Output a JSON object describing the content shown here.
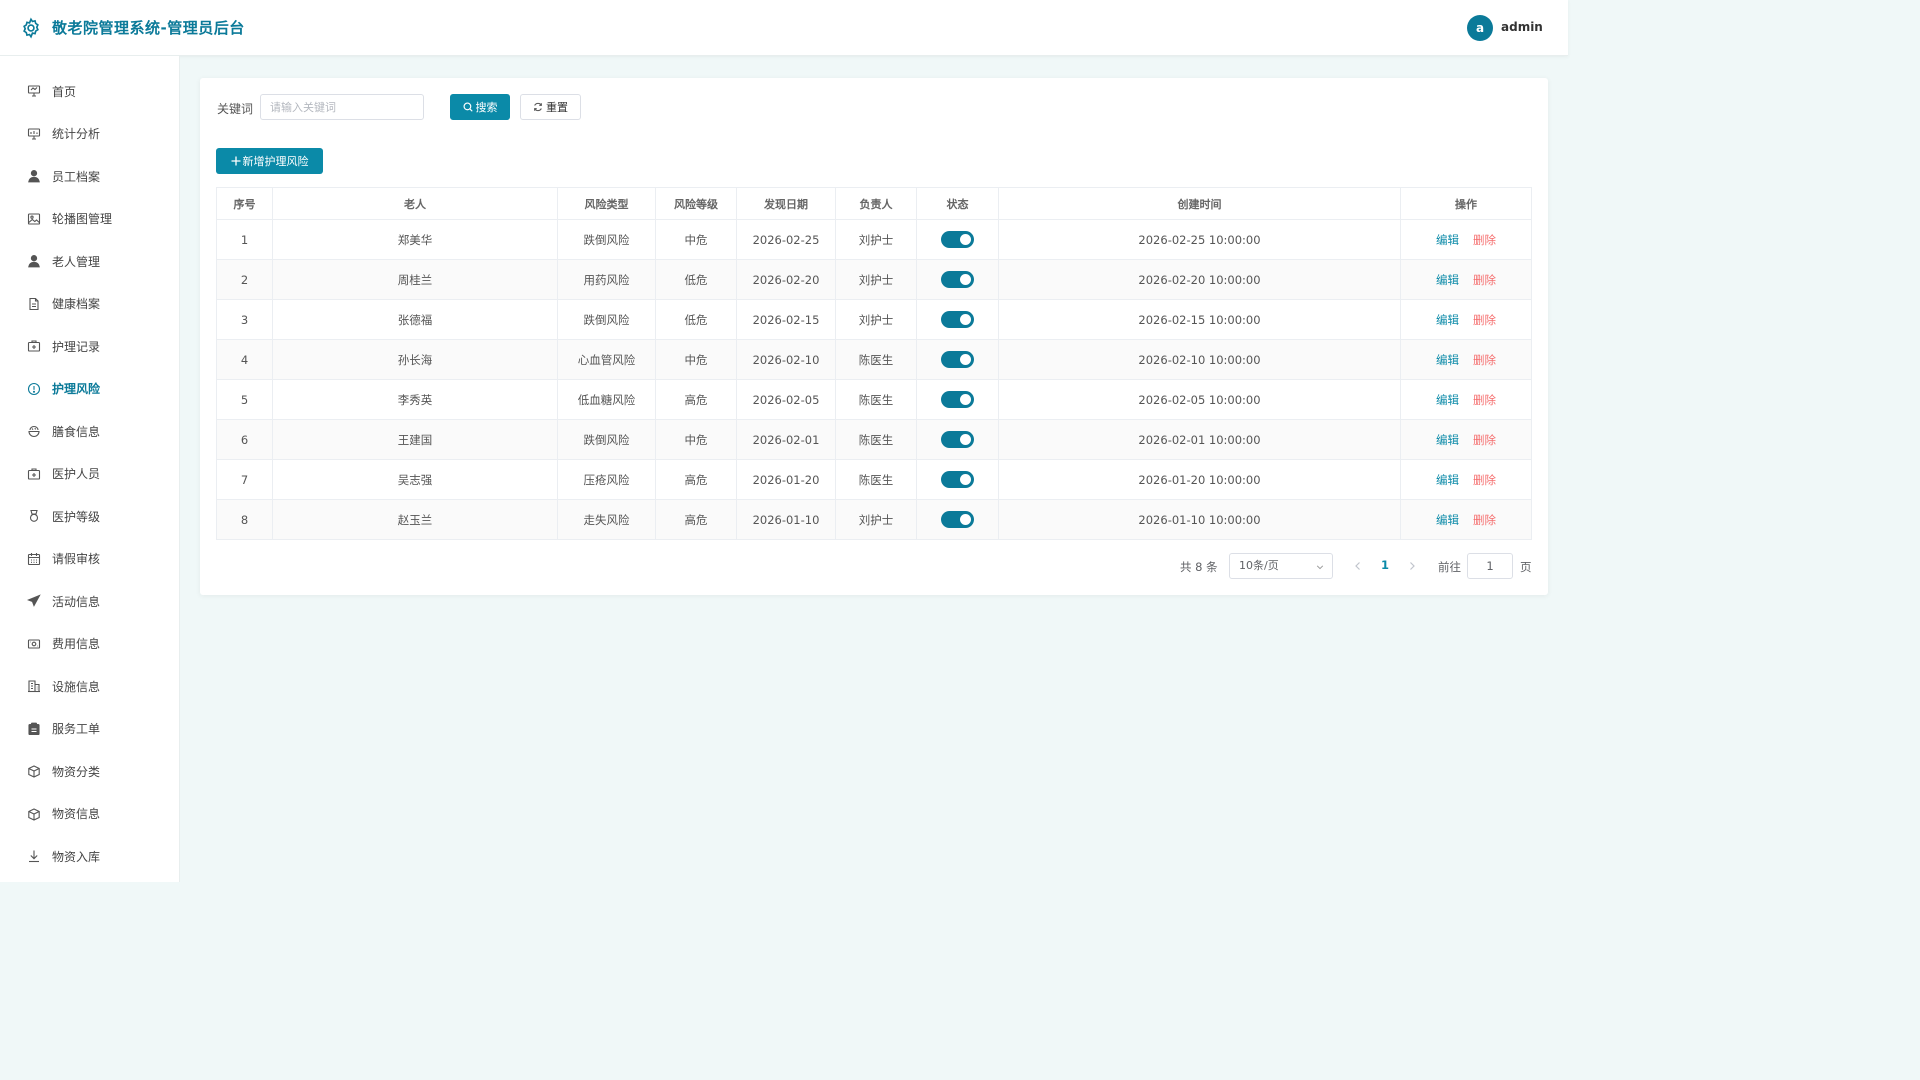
{
  "header": {
    "title": "敬老院管理系统-管理员后台",
    "avatar_letter": "a",
    "username": "admin"
  },
  "sidebar": {
    "items": [
      {
        "label": "首页",
        "icon": "presentation-icon"
      },
      {
        "label": "统计分析",
        "icon": "chart-board-icon"
      },
      {
        "label": "员工档案",
        "icon": "user-icon"
      },
      {
        "label": "轮播图管理",
        "icon": "picture-icon"
      },
      {
        "label": "老人管理",
        "icon": "user-icon"
      },
      {
        "label": "健康档案",
        "icon": "document-icon"
      },
      {
        "label": "护理记录",
        "icon": "first-aid-icon"
      },
      {
        "label": "护理风险",
        "icon": "warning-circle-icon",
        "active": true
      },
      {
        "label": "膳食信息",
        "icon": "food-icon"
      },
      {
        "label": "医护人员",
        "icon": "first-aid-icon"
      },
      {
        "label": "医护等级",
        "icon": "medal-icon"
      },
      {
        "label": "请假审核",
        "icon": "calendar-icon"
      },
      {
        "label": "活动信息",
        "icon": "paper-plane-icon"
      },
      {
        "label": "费用信息",
        "icon": "money-icon"
      },
      {
        "label": "设施信息",
        "icon": "office-building-icon"
      },
      {
        "label": "服务工单",
        "icon": "clipboard-icon"
      },
      {
        "label": "物资分类",
        "icon": "box-icon"
      },
      {
        "label": "物资信息",
        "icon": "box-icon"
      },
      {
        "label": "物资入库",
        "icon": "download-icon"
      }
    ]
  },
  "search": {
    "keyword_label": "关键词",
    "placeholder": "请输入关键词",
    "search_label": "搜索",
    "reset_label": "重置"
  },
  "toolbar": {
    "add_label": "新增护理风险"
  },
  "table": {
    "columns": [
      "序号",
      "老人",
      "风险类型",
      "风险等级",
      "发现日期",
      "负责人",
      "状态",
      "创建时间",
      "操作"
    ],
    "rows": [
      {
        "no": "1",
        "elder": "郑美华",
        "type": "跌倒风险",
        "level": "中危",
        "date": "2026-02-25",
        "owner": "刘护士",
        "status": true,
        "created": "2026-02-25 10:00:00"
      },
      {
        "no": "2",
        "elder": "周桂兰",
        "type": "用药风险",
        "level": "低危",
        "date": "2026-02-20",
        "owner": "刘护士",
        "status": true,
        "created": "2026-02-20 10:00:00"
      },
      {
        "no": "3",
        "elder": "张德福",
        "type": "跌倒风险",
        "level": "低危",
        "date": "2026-02-15",
        "owner": "刘护士",
        "status": true,
        "created": "2026-02-15 10:00:00"
      },
      {
        "no": "4",
        "elder": "孙长海",
        "type": "心血管风险",
        "level": "中危",
        "date": "2026-02-10",
        "owner": "陈医生",
        "status": true,
        "created": "2026-02-10 10:00:00"
      },
      {
        "no": "5",
        "elder": "李秀英",
        "type": "低血糖风险",
        "level": "高危",
        "date": "2026-02-05",
        "owner": "陈医生",
        "status": true,
        "created": "2026-02-05 10:00:00"
      },
      {
        "no": "6",
        "elder": "王建国",
        "type": "跌倒风险",
        "level": "中危",
        "date": "2026-02-01",
        "owner": "陈医生",
        "status": true,
        "created": "2026-02-01 10:00:00"
      },
      {
        "no": "7",
        "elder": "吴志强",
        "type": "压疮风险",
        "level": "高危",
        "date": "2026-01-20",
        "owner": "陈医生",
        "status": true,
        "created": "2026-01-20 10:00:00"
      },
      {
        "no": "8",
        "elder": "赵玉兰",
        "type": "走失风险",
        "level": "高危",
        "date": "2026-01-10",
        "owner": "刘护士",
        "status": true,
        "created": "2026-01-10 10:00:00"
      }
    ],
    "edit_label": "编辑",
    "delete_label": "删除"
  },
  "pagination": {
    "total_text": "共 8 条",
    "page_size": "10条/页",
    "current_page": "1",
    "goto_label": "前往",
    "goto_value": "1",
    "page_suffix": "页"
  },
  "colors": {
    "primary": "#0b8aa8",
    "danger": "#f56c6c",
    "background": "#f0f8f8"
  }
}
